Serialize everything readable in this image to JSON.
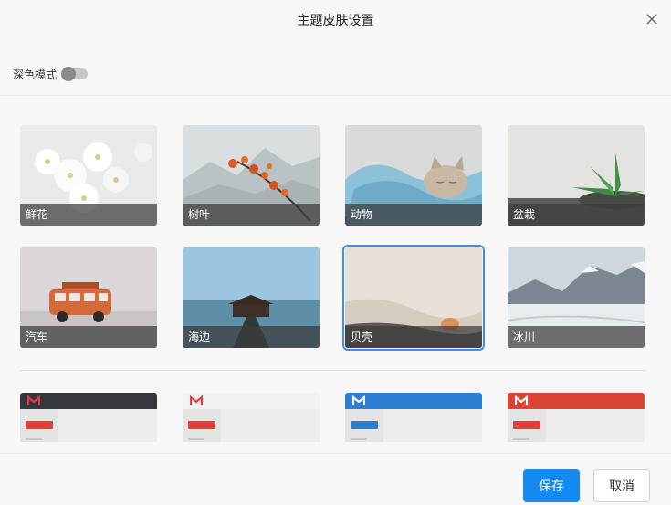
{
  "dialog": {
    "title": "主题皮肤设置"
  },
  "dark_mode": {
    "label": "深色模式",
    "enabled": false
  },
  "themes": [
    {
      "label": "鲜花",
      "icon": "flowers-image"
    },
    {
      "label": "树叶",
      "icon": "leaves-image"
    },
    {
      "label": "动物",
      "icon": "kitten-image"
    },
    {
      "label": "盆栽",
      "icon": "succulent-image"
    },
    {
      "label": "汽车",
      "icon": "toy-bus-image"
    },
    {
      "label": "海边",
      "icon": "pier-image"
    },
    {
      "label": "贝壳",
      "icon": "shell-image",
      "selected": true
    },
    {
      "label": "冰川",
      "icon": "glacier-image"
    }
  ],
  "color_themes": [
    {
      "bar_color": "#34373b",
      "accent": "#e83b3b"
    },
    {
      "bar_color": "#f2f2f2",
      "accent": "#e83b3b"
    },
    {
      "bar_color": "#2d7fd6",
      "accent": "#2d7fd6"
    },
    {
      "bar_color": "#dd4438",
      "accent": "#e83b3b"
    }
  ],
  "footer": {
    "save_label": "保存",
    "cancel_label": "取消"
  }
}
